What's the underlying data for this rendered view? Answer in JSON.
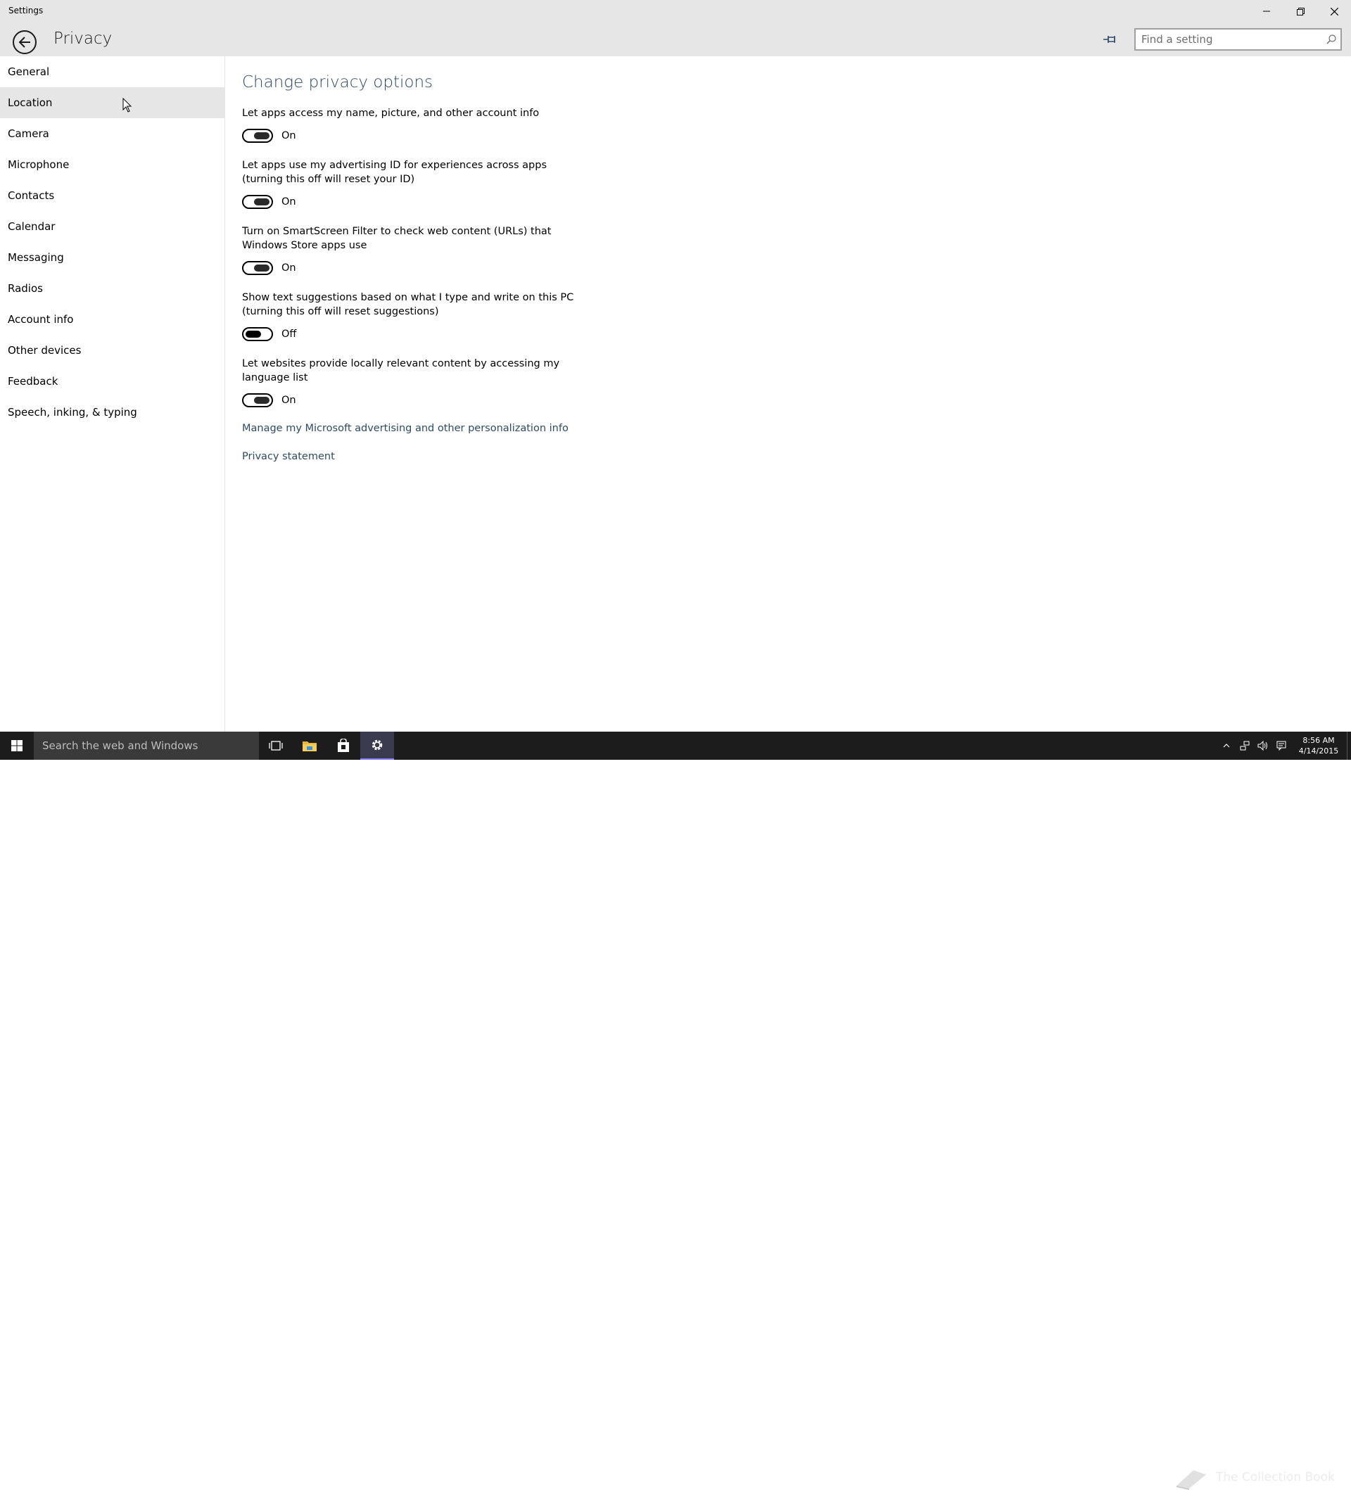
{
  "window": {
    "title": "Settings"
  },
  "header": {
    "page_title": "Privacy",
    "search_placeholder": "Find a setting"
  },
  "sidebar": {
    "items": [
      {
        "label": "General"
      },
      {
        "label": "Location"
      },
      {
        "label": "Camera"
      },
      {
        "label": "Microphone"
      },
      {
        "label": "Contacts"
      },
      {
        "label": "Calendar"
      },
      {
        "label": "Messaging"
      },
      {
        "label": "Radios"
      },
      {
        "label": "Account info"
      },
      {
        "label": "Other devices"
      },
      {
        "label": "Feedback"
      },
      {
        "label": "Speech, inking, & typing"
      }
    ]
  },
  "main": {
    "section_title": "Change privacy options",
    "options": [
      {
        "line1": "Let apps access my name, picture, and other account info",
        "line2": "",
        "state": "On"
      },
      {
        "line1": "Let apps use my advertising ID for experiences across apps",
        "line2": "(turning this off will reset your ID)",
        "state": "On"
      },
      {
        "line1": "Turn on SmartScreen Filter to check web content (URLs) that",
        "line2": "Windows Store apps use",
        "state": "On"
      },
      {
        "line1": "Show text suggestions based on what I type and write on this PC",
        "line2": "(turning this off will reset suggestions)",
        "state": "Off"
      },
      {
        "line1": "Let websites provide locally relevant content by accessing my",
        "line2": "language list",
        "state": "On"
      }
    ],
    "links": {
      "manage": "Manage my Microsoft advertising and other personalization info",
      "privacy_statement": "Privacy statement"
    }
  },
  "taskbar": {
    "search_text": "Search the web and Windows",
    "clock_time": "8:56 AM",
    "clock_date": "4/14/2015",
    "watermark": "The Collection Book"
  },
  "icons": {
    "back": "back-arrow-icon",
    "pin": "pin-icon",
    "search": "search-icon",
    "minimize": "minimize-icon",
    "restore": "restore-icon",
    "close": "close-icon"
  }
}
